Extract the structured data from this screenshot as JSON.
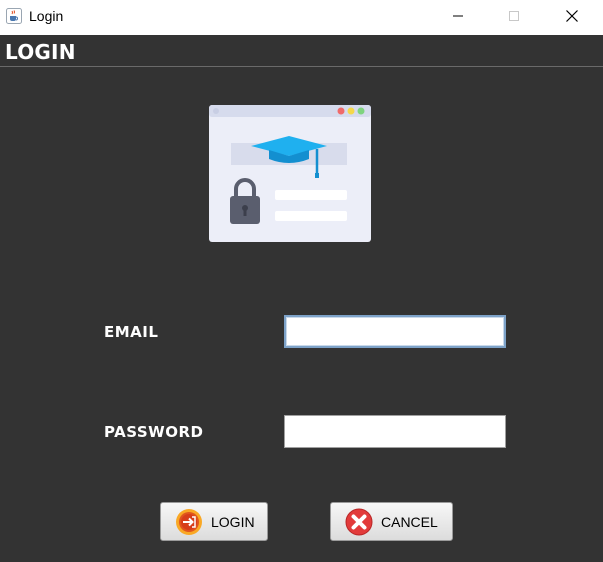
{
  "window": {
    "title": "Login"
  },
  "header": {
    "title": "LOGIN"
  },
  "form": {
    "email_label": "EMAIL",
    "email_value": "",
    "password_label": "PASSWORD",
    "password_value": ""
  },
  "buttons": {
    "login_label": "LOGIN",
    "cancel_label": "CANCEL"
  },
  "icons": {
    "app": "java-coffee-cup-icon",
    "minimize": "minimize-icon",
    "maximize": "maximize-icon",
    "close": "close-icon",
    "illustration": "graduation-cap-lock-illustration",
    "login": "login-arrow-icon",
    "cancel": "cancel-x-icon"
  },
  "colors": {
    "background": "#333333",
    "title_bar": "#ffffff",
    "accent_blue": "#29a8e8",
    "cancel_red": "#e23b3b",
    "login_orange": "#f28c1e"
  }
}
